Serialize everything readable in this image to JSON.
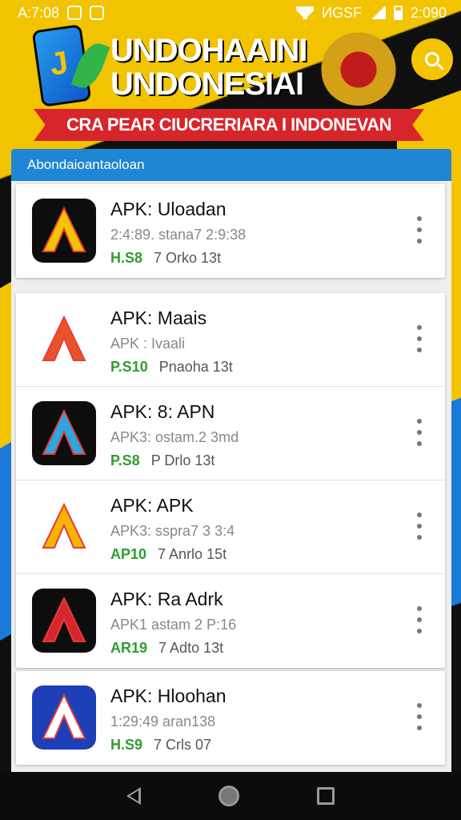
{
  "status_bar": {
    "left_text": "A:7:08",
    "carrier_text": "ИGSF",
    "time": "2:090"
  },
  "header": {
    "title_line1": "UNDOHAAINI",
    "title_line2": "UNDONESIAI",
    "ribbon_text": "CRA PEAR CIUCRERIARA I INDONEVAN",
    "search_icon": "search-icon"
  },
  "list": {
    "section_title": "Abondaioantaoloan",
    "apps": [
      {
        "title": "APK: Uloadan",
        "subtitle": "2:4:89. stana7 2:9:38",
        "tag": "H.S8",
        "meta": "7  Orko 13t",
        "icon_bg": "#0d0d0d",
        "icon_accent": "#f5c400"
      },
      {
        "title": "APK: Maais",
        "subtitle": "APK : Ivaali",
        "tag": "P.S10",
        "meta": "Pnaoha 13t",
        "icon_bg": "#ffffff",
        "icon_accent": "#e8542a"
      },
      {
        "title": "APK: 8: APN",
        "subtitle": "APK3:  ostam.2 3md",
        "tag": "P.S8",
        "meta": "P  Drlo 13t",
        "icon_bg": "#0d0d0d",
        "icon_accent": "#2aa8e0"
      },
      {
        "title": "APK: APK",
        "subtitle": "APK3:  sspra7 3 3:4",
        "tag": "AP10",
        "meta": "7  Anrlo 15t",
        "icon_bg": "#ffffff",
        "icon_accent": "#f5b400"
      },
      {
        "title": "APK: Ra Adrk",
        "subtitle": "APK1   astam 2 P:16",
        "tag": "AR19",
        "meta": "7  Adto 13t",
        "icon_bg": "#0d0d0d",
        "icon_accent": "#d7262b"
      },
      {
        "title": "APK: Hloohan",
        "subtitle": "1:29:49 aran138",
        "tag": "H.S9",
        "meta": "7  Crls 07",
        "icon_bg": "#1d3fb8",
        "icon_accent": "#ffffff"
      }
    ]
  },
  "nav": {
    "back_icon": "back-icon",
    "home_icon": "home-icon",
    "recent_icon": "recent-apps-icon"
  }
}
